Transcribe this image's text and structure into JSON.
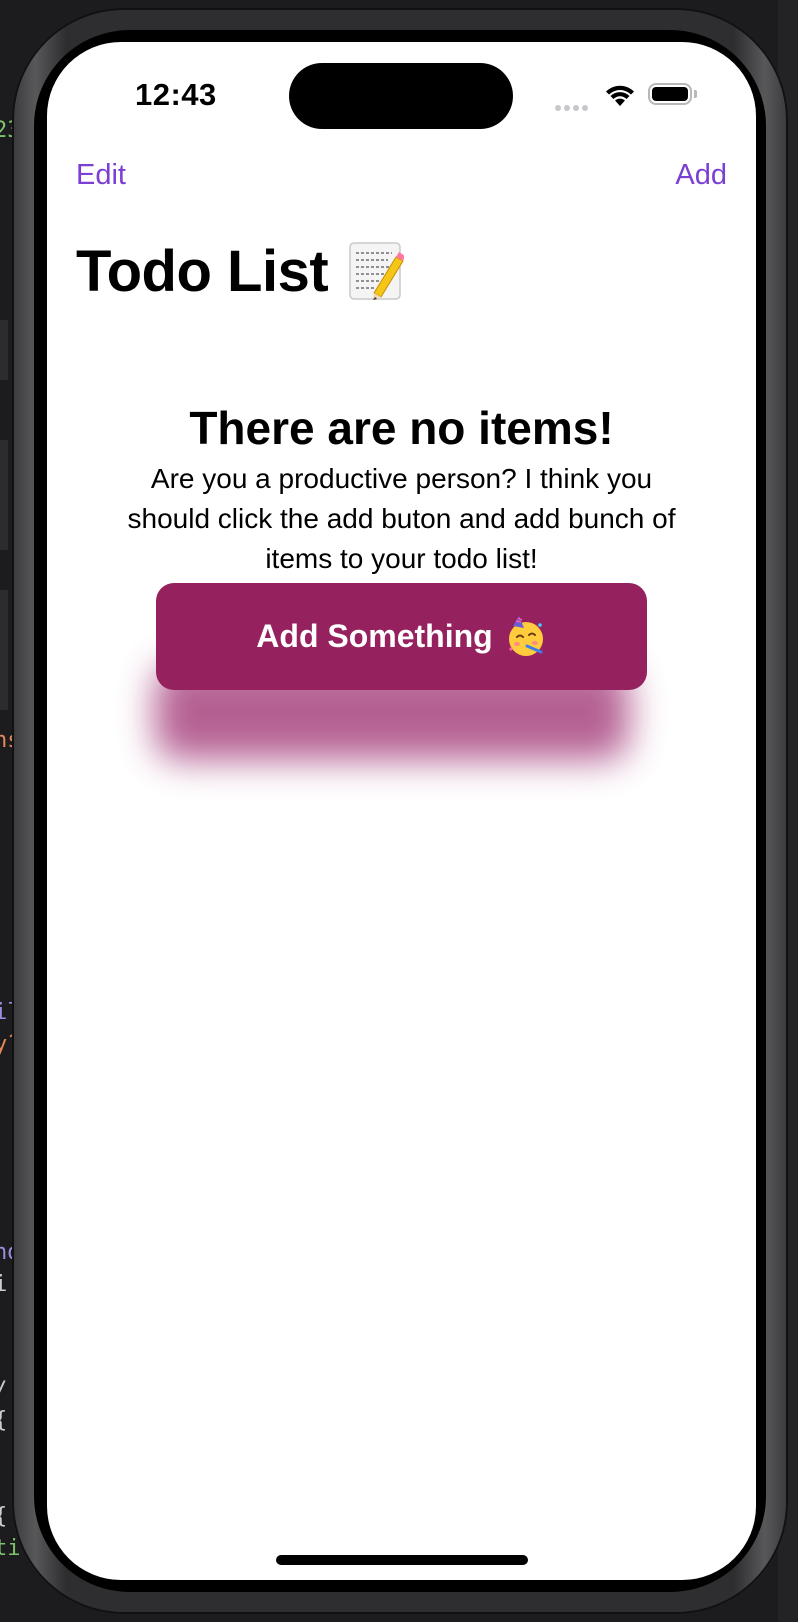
{
  "status_bar": {
    "time": "12:43"
  },
  "nav": {
    "edit_label": "Edit",
    "add_label": "Add"
  },
  "page": {
    "title": "Todo List",
    "title_icon": "memo-icon"
  },
  "empty_state": {
    "title": "There are no items!",
    "message": "Are you a productive person? I think you should click the add buton and add bunch of items to your todo list!",
    "button_label": "Add Something",
    "button_icon": "partying-face-icon"
  },
  "colors": {
    "accent": "#7b3fd4",
    "button": "#95225f",
    "button_shadow": "#a84580",
    "background": "#ffffff"
  }
}
